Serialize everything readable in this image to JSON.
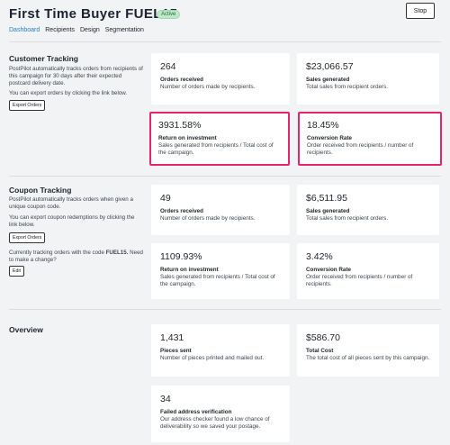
{
  "header": {
    "title": "First Time Buyer FUEL15",
    "status_badge": "Active",
    "stop_label": "Stop"
  },
  "nav": {
    "tabs": [
      {
        "label": "Dashboard",
        "active": true
      },
      {
        "label": "Recipients",
        "active": false
      },
      {
        "label": "Design",
        "active": false
      },
      {
        "label": "Segmentation",
        "active": false
      }
    ]
  },
  "customer_tracking": {
    "title": "Customer Tracking",
    "description": "PostPilot automatically tracks orders from recipients of this campaign for 30 days after their expected postcard delivery date.",
    "export_hint": "You can export orders by clicking the link below.",
    "export_label": "Export Orders",
    "cards": [
      {
        "value": "264",
        "label": "Orders received",
        "desc": "Number of orders made by recipients."
      },
      {
        "value": "$23,066.57",
        "label": "Sales generated",
        "desc": "Total sales from recipient orders."
      },
      {
        "value": "3931.58%",
        "label": "Return on investment",
        "desc": "Sales generated from recipients / Total cost of the campaign."
      },
      {
        "value": "18.45%",
        "label": "Conversion Rate",
        "desc": "Order received from recipients / number of recipients."
      }
    ]
  },
  "coupon_tracking": {
    "title": "Coupon Tracking",
    "description": "PostPilot automatically tracks orders when given a unique coupon code.",
    "export_hint": "You can export coupon redemptions by clicking the link below.",
    "export_label": "Export Orders",
    "code_text_prefix": "Currently tracking orders with the code",
    "code": "FUEL15.",
    "change_prompt": "Need to make a change?",
    "edit_label": "Edit",
    "cards": [
      {
        "value": "49",
        "label": "Orders received",
        "desc": "Number of orders made by recipients."
      },
      {
        "value": "$6,511.95",
        "label": "Sales generated",
        "desc": "Total sales from recipient orders."
      },
      {
        "value": "1109.93%",
        "label": "Return on investment",
        "desc": "Sales generated from recipients / Total cost of the campaign."
      },
      {
        "value": "3.42%",
        "label": "Conversion Rate",
        "desc": "Order received from recipients / number of recipients."
      }
    ]
  },
  "overview": {
    "title": "Overview",
    "cards": [
      {
        "value": "1,431",
        "label": "Pieces sent",
        "desc": "Number of pieces printed and mailed out."
      },
      {
        "value": "$586.70",
        "label": "Total Cost",
        "desc": "The total cost of all pieces sent by this campaign."
      },
      {
        "value": "34",
        "label": "Failed address verification",
        "desc": "Our address checker found a low chance of deliverability so we saved your postage."
      }
    ]
  }
}
